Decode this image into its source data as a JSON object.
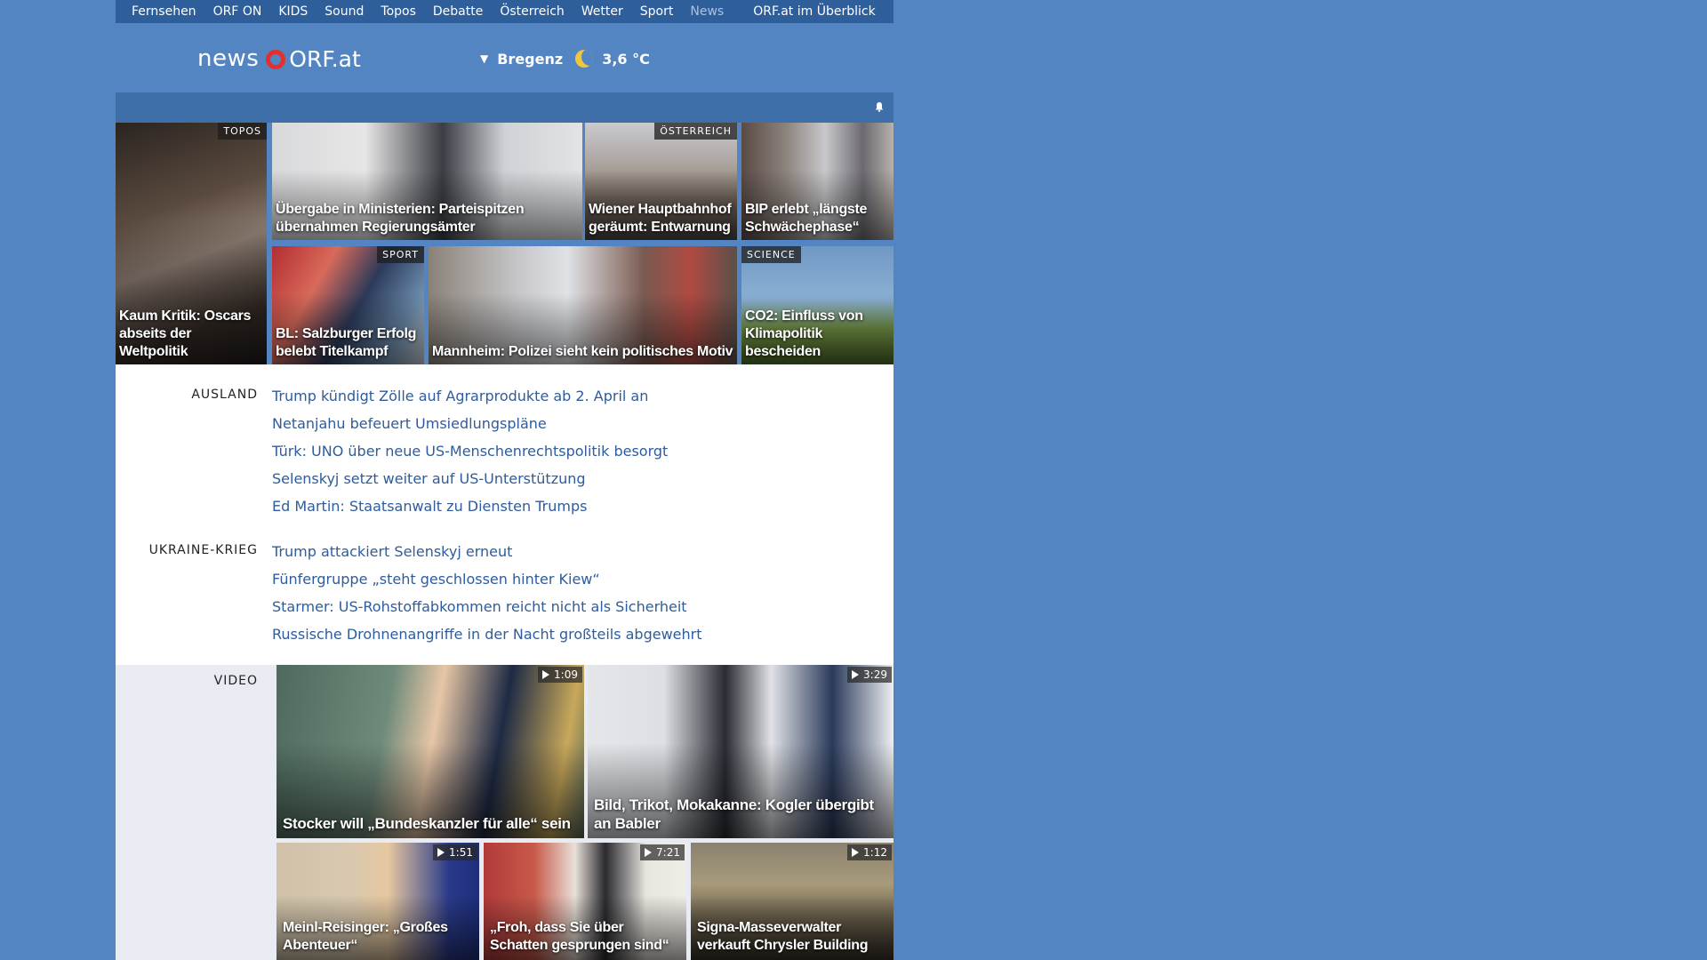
{
  "topnav": {
    "items": [
      "Fernsehen",
      "ORF ON",
      "KIDS",
      "Sound",
      "Topos",
      "Debatte",
      "Österreich",
      "Wetter",
      "Sport",
      "News"
    ],
    "active": "News",
    "overview": "ORF.at im Überblick"
  },
  "brand": {
    "news": "news",
    "orf": "ORF.at"
  },
  "weather": {
    "location": "Bregenz",
    "temperature": "3,6 °C",
    "icon": "moon-icon"
  },
  "tiles": [
    {
      "caption": "Kaum Kritik: Oscars abseits der Weltpolitik",
      "tag": "TOPOS"
    },
    {
      "caption": "Übergabe in Ministerien: Parteispitzen übernahmen Regierungsämter",
      "tag": ""
    },
    {
      "caption": "Wiener Hauptbahnhof geräumt: Entwarnung",
      "tag": "ÖSTERREICH"
    },
    {
      "caption": "BIP erlebt „längste Schwächephase“",
      "tag": ""
    },
    {
      "caption": "BL: Salzburger Erfolg belebt Titelkampf",
      "tag": "SPORT"
    },
    {
      "caption": "Mannheim: Polizei sieht kein politisches Motiv",
      "tag": ""
    },
    {
      "caption": "CO2: Einfluss von Klimapolitik bescheiden",
      "tag": "SCIENCE"
    }
  ],
  "sections": [
    {
      "label": "AUSLAND",
      "links": [
        "Trump kündigt Zölle auf Agrarprodukte ab 2. April an",
        "Netanjahu befeuert Umsiedlungspläne",
        "Türk: UNO über neue US-Menschenrechtspolitik besorgt",
        "Selenskyj setzt weiter auf US-Unterstützung",
        "Ed Martin: Staatsanwalt zu Diensten Trumps"
      ]
    },
    {
      "label": "UKRAINE-KRIEG",
      "links": [
        "Trump attackiert Selenskyj erneut",
        "Fünfergruppe „steht geschlossen hinter Kiew“",
        "Starmer: US-Rohstoffabkommen reicht nicht als Sicherheit",
        "Russische Drohnenangriffe in der Nacht großteils abgewehrt"
      ]
    }
  ],
  "video": {
    "label": "VIDEO",
    "items": [
      {
        "caption": "Stocker will „Bundeskanzler für alle“ sein",
        "duration": "1:09"
      },
      {
        "caption": "Bild, Trikot, Mokakanne: Kogler übergibt an Babler",
        "duration": "3:29"
      },
      {
        "caption": "Meinl-Reisinger: „Großes Abenteuer“",
        "duration": "1:51"
      },
      {
        "caption": "„Froh, dass Sie über Schatten gesprungen sind“",
        "duration": "7:21"
      },
      {
        "caption": "Signa-Masseverwalter verkauft Chrysler Building",
        "duration": "1:12"
      }
    ]
  },
  "colors": {
    "background": "#5385c2",
    "nav": "#2e5f9a",
    "link": "#2e5c9c",
    "orf_red": "#e2302d"
  }
}
